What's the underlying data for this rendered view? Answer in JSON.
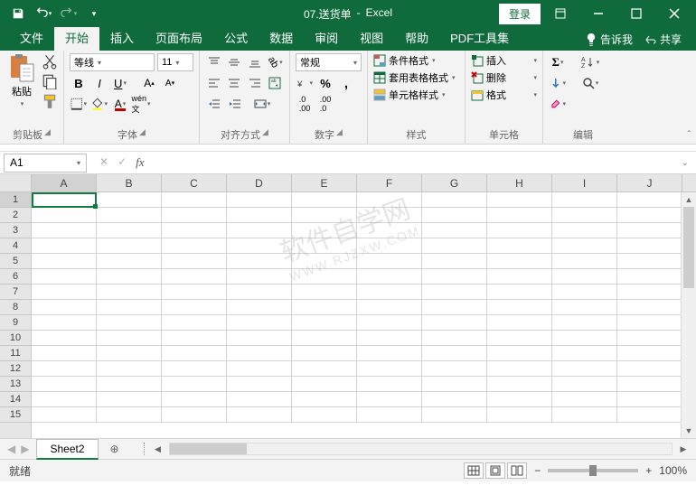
{
  "title": {
    "doc": "07.送货单",
    "sep": " - ",
    "app": "Excel"
  },
  "titlebar": {
    "login": "登录"
  },
  "tabs": [
    "文件",
    "开始",
    "插入",
    "页面布局",
    "公式",
    "数据",
    "审阅",
    "视图",
    "帮助",
    "PDF工具集"
  ],
  "active_tab": 1,
  "tell_me": "告诉我",
  "share": "共享",
  "ribbon": {
    "clipboard": {
      "paste": "粘贴",
      "label": "剪贴板"
    },
    "font": {
      "name": "等线",
      "size": "11",
      "label": "字体"
    },
    "align": {
      "label": "对齐方式",
      "wrap_char": "ab"
    },
    "number": {
      "label": "数字",
      "format": "常规"
    },
    "styles": {
      "cond": "条件格式",
      "table": "套用表格格式",
      "cell": "单元格样式",
      "label": "样式"
    },
    "cells": {
      "insert": "插入",
      "delete": "删除",
      "format": "格式",
      "label": "单元格"
    },
    "editing": {
      "label": "编辑"
    }
  },
  "name_box": "A1",
  "columns": [
    "A",
    "B",
    "C",
    "D",
    "E",
    "F",
    "G",
    "H",
    "I",
    "J"
  ],
  "rows": [
    1,
    2,
    3,
    4,
    5,
    6,
    7,
    8,
    9,
    10,
    11,
    12,
    13,
    14,
    15
  ],
  "active_cell": {
    "row": 0,
    "col": 0
  },
  "sheet": "Sheet2",
  "status": {
    "ready": "就绪",
    "zoom": "100%",
    "minus": "−",
    "plus": "+"
  },
  "watermark": {
    "main": "软件自学网",
    "sub": "WWW.RJZXW.COM"
  }
}
